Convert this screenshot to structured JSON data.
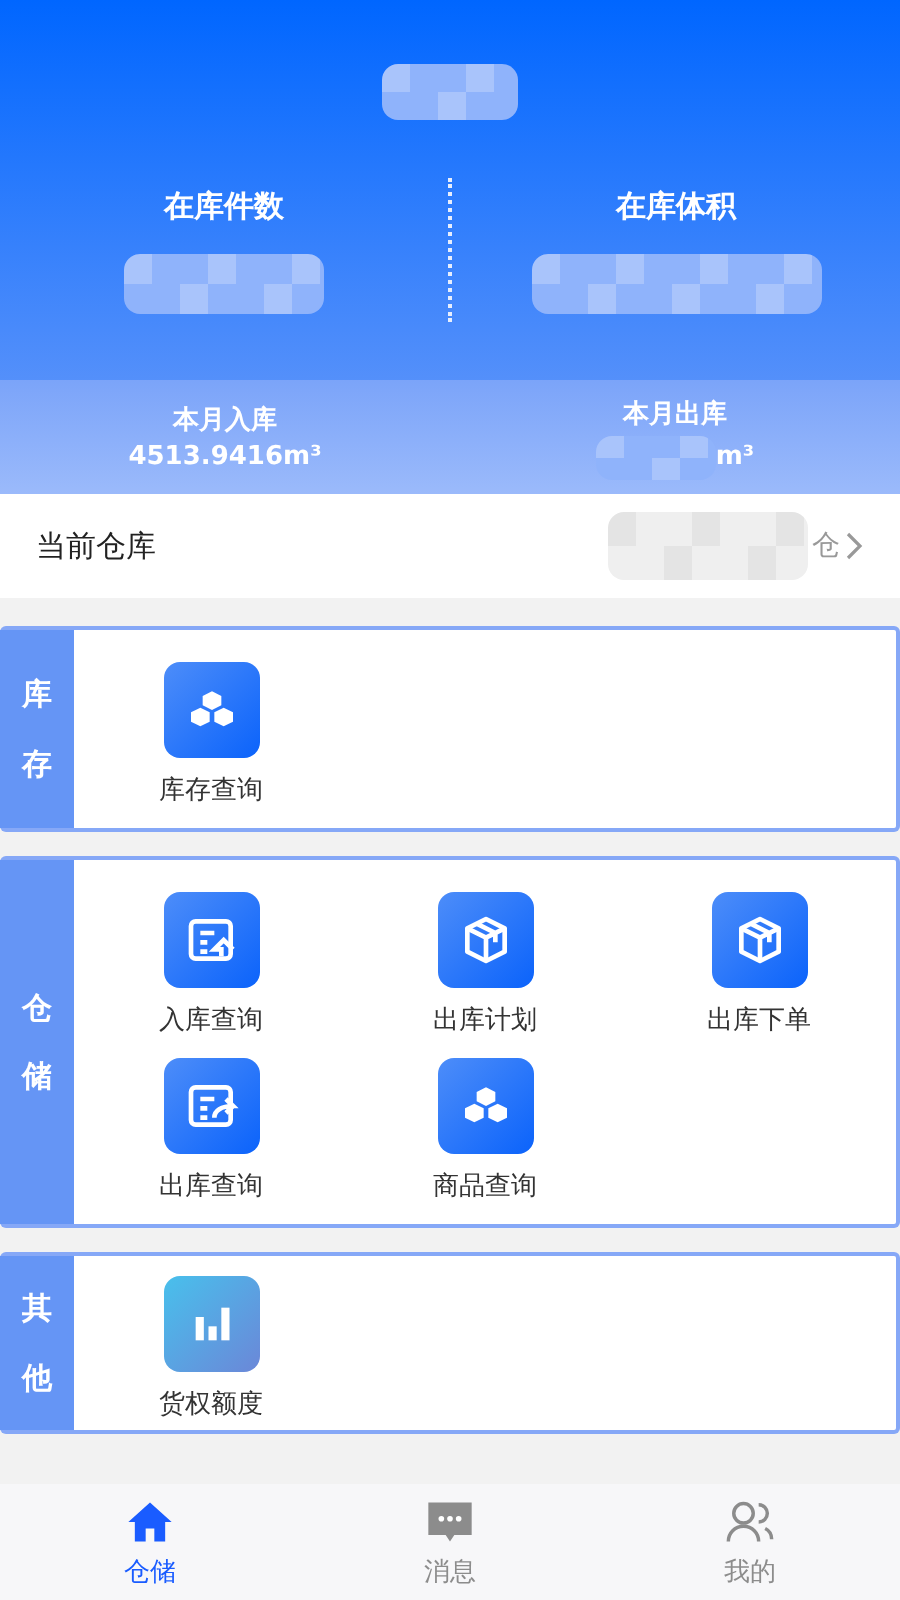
{
  "stats": {
    "top": [
      {
        "label": "在库件数"
      },
      {
        "label": "在库体积"
      }
    ],
    "month": [
      {
        "label": "本月入库",
        "value": "4513.9416m³"
      },
      {
        "label": "本月出库",
        "value": "m³"
      }
    ]
  },
  "current_warehouse": {
    "label": "当前仓库",
    "value": "仓"
  },
  "sections": [
    {
      "title": "库存",
      "items": [
        {
          "label": "库存查询",
          "kind": "cubes"
        }
      ]
    },
    {
      "title": "仓储",
      "items": [
        {
          "label": "入库查询",
          "kind": "doc-in"
        },
        {
          "label": "出库计划",
          "kind": "box"
        },
        {
          "label": "出库下单",
          "kind": "box"
        },
        {
          "label": "出库查询",
          "kind": "doc-out"
        },
        {
          "label": "商品查询",
          "kind": "cubes"
        }
      ]
    },
    {
      "title": "其他",
      "items": [
        {
          "label": "货权额度",
          "kind": "chart"
        }
      ]
    }
  ],
  "tabs": [
    {
      "label": "仓储",
      "kind": "home",
      "selected": true
    },
    {
      "label": "消息",
      "kind": "chat",
      "selected": false
    },
    {
      "label": "我的",
      "kind": "people",
      "selected": false
    }
  ]
}
